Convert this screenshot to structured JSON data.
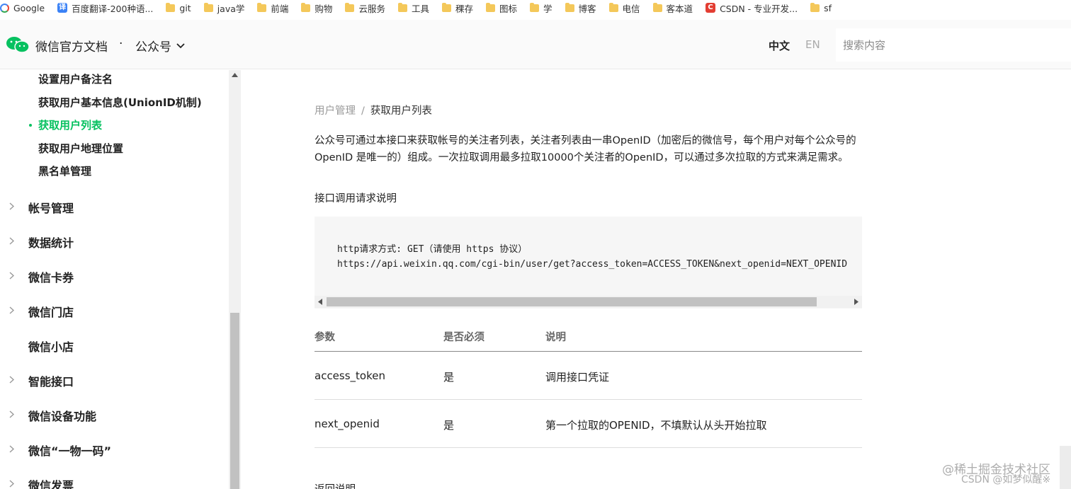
{
  "bookmarks": [
    {
      "label": "Google",
      "icon": "google-icon"
    },
    {
      "label": "百度翻译-200种语...",
      "icon": "baidu-fanyi-icon"
    },
    {
      "label": "git",
      "icon": "folder-icon"
    },
    {
      "label": "java学",
      "icon": "folder-icon"
    },
    {
      "label": "前端",
      "icon": "folder-icon"
    },
    {
      "label": "购物",
      "icon": "folder-icon"
    },
    {
      "label": "云服务",
      "icon": "folder-icon"
    },
    {
      "label": "工具",
      "icon": "folder-icon"
    },
    {
      "label": "稞存",
      "icon": "folder-icon"
    },
    {
      "label": "图标",
      "icon": "folder-icon"
    },
    {
      "label": "学",
      "icon": "folder-icon"
    },
    {
      "label": "博客",
      "icon": "folder-icon"
    },
    {
      "label": "电信",
      "icon": "folder-icon"
    },
    {
      "label": "客本道",
      "icon": "folder-icon"
    },
    {
      "label": "CSDN - 专业开发...",
      "icon": "csdn-icon"
    },
    {
      "label": "sf",
      "icon": "folder-icon"
    }
  ],
  "header": {
    "brand": "微信官方文档",
    "separator": "·",
    "product": "公众号",
    "lang_zh": "中文",
    "lang_en": "EN",
    "search_placeholder": "搜索内容",
    "brand_color": "#07c160"
  },
  "sidebar": {
    "sub_items": [
      {
        "label": "设置用户备注名",
        "active": false
      },
      {
        "label": "获取用户基本信息(UnionID机制)",
        "active": false
      },
      {
        "label": "获取用户列表",
        "active": true
      },
      {
        "label": "获取用户地理位置",
        "active": false
      },
      {
        "label": "黑名单管理",
        "active": false
      }
    ],
    "categories": [
      {
        "label": "帐号管理",
        "expandable": true
      },
      {
        "label": "数据统计",
        "expandable": true
      },
      {
        "label": "微信卡券",
        "expandable": true
      },
      {
        "label": "微信门店",
        "expandable": true
      },
      {
        "label": "微信小店",
        "expandable": false
      },
      {
        "label": "智能接口",
        "expandable": true
      },
      {
        "label": "微信设备功能",
        "expandable": true
      },
      {
        "label": "微信“一物一码”",
        "expandable": true
      },
      {
        "label": "微信发票",
        "expandable": true
      }
    ]
  },
  "content": {
    "breadcrumb": {
      "parent": "用户管理",
      "separator": "/",
      "current": "获取用户列表"
    },
    "intro": "公众号可通过本接口来获取帐号的关注者列表，关注者列表由一串OpenID（加密后的微信号，每个用户对每个公众号的 OpenID 是唯一的）组成。一次拉取调用最多拉取10000个关注者的OpenID，可以通过多次拉取的方式来满足需求。",
    "request_label": "接口调用请求说明",
    "code_lines": [
      "http请求方式: GET（请使用 https 协议）",
      "https://api.weixin.qq.com/cgi-bin/user/get?access_token=ACCESS_TOKEN&next_openid=NEXT_OPENID"
    ],
    "table": {
      "headers": [
        "参数",
        "是否必须",
        "说明"
      ],
      "rows": [
        [
          "access_token",
          "是",
          "调用接口凭证"
        ],
        [
          "next_openid",
          "是",
          "第一个拉取的OPENID，不填默认从头开始拉取"
        ]
      ]
    },
    "returns_label": "返回说明"
  },
  "watermark": {
    "line1": "@稀土掘金技术社区",
    "line2": "CSDN @如梦似醒※"
  }
}
